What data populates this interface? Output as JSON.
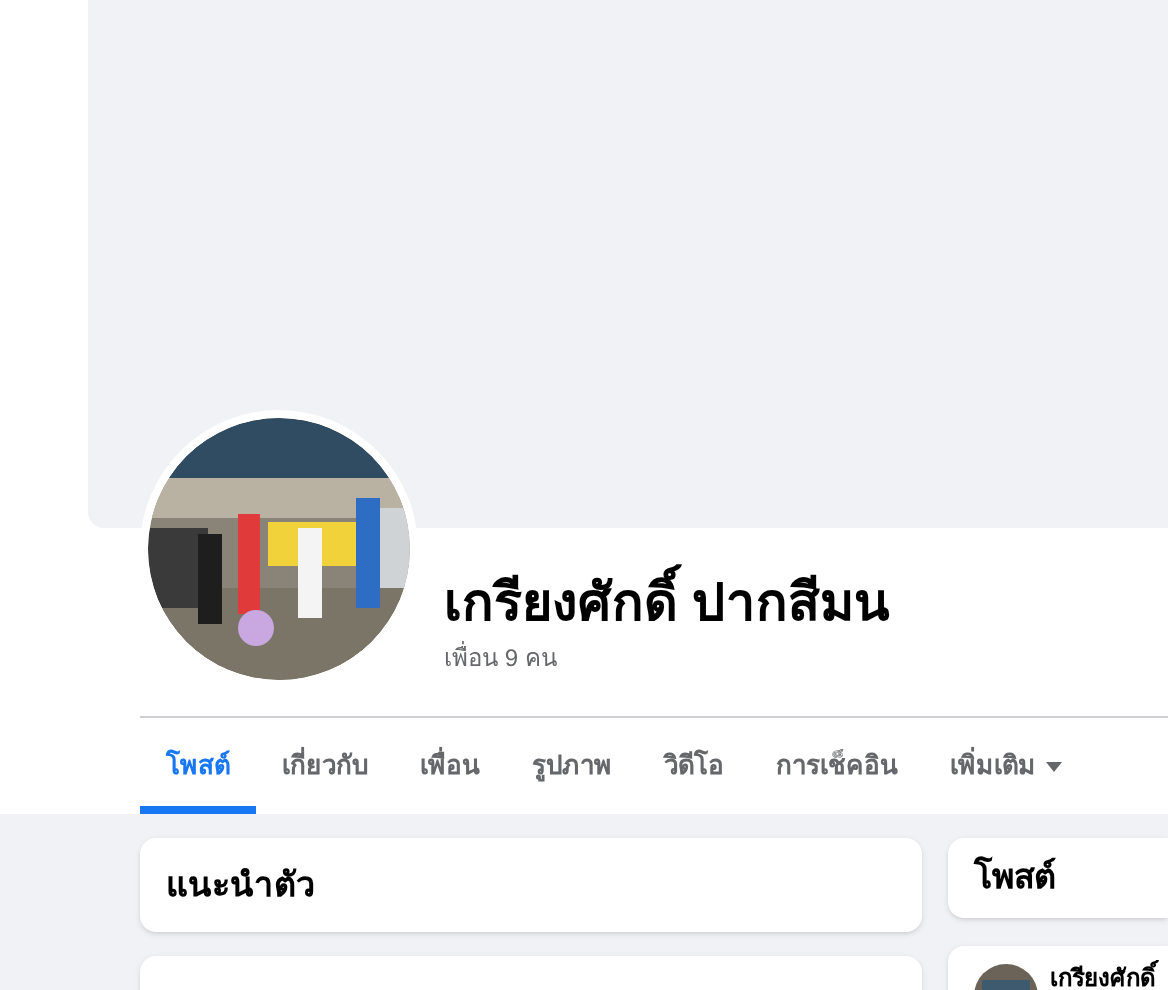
{
  "profile": {
    "kind": "picture",
    "name": "เกรียงศักดิ์ ปากสีมน",
    "friends": "เพื่อน 9 คน"
  },
  "tabs": [
    {
      "label": "โพสต์",
      "selected": true
    },
    {
      "label": "เกี่ยวกับ",
      "selected": false
    },
    {
      "label": "เพื่อน",
      "selected": false
    },
    {
      "label": "รูปภาพ",
      "selected": false
    },
    {
      "label": "วิดีโอ",
      "selected": false
    },
    {
      "label": "การเช็คอิน",
      "selected": false
    },
    {
      "label": "เพิ่มเติม",
      "selected": false,
      "dropdown": true
    }
  ],
  "intro_card": {
    "title": "แนะนำตัว"
  },
  "posts_card": {
    "title": "โพสต์"
  },
  "post": {
    "author": "เกรียงศักดิ์"
  }
}
